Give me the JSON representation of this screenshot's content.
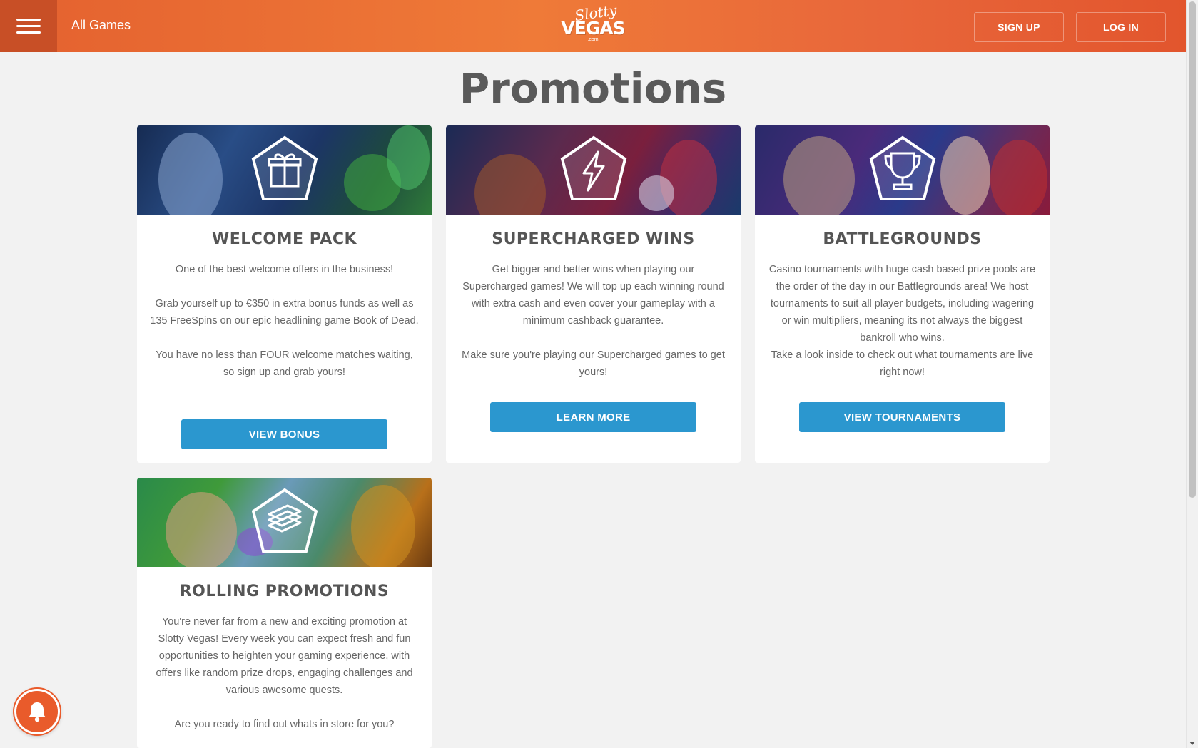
{
  "header": {
    "all_games_label": "All Games",
    "logo_top": "Slotty",
    "logo_main": "VEGAS",
    "logo_sub": ".com",
    "signup_label": "SIGN UP",
    "login_label": "LOG IN"
  },
  "page": {
    "title": "Promotions"
  },
  "colors": {
    "header_orange": "#ef7a38",
    "button_blue": "#2b97cf",
    "bell_orange": "#e95b2b"
  },
  "cards": [
    {
      "title": "WELCOME PACK",
      "icon": "gift-icon",
      "paragraphs": [
        "One of the best welcome offers in the business!",
        "Grab yourself up to €350 in extra bonus funds as well as 135 FreeSpins on our epic headlining game Book of Dead.",
        "You have no less than FOUR welcome matches waiting, so sign up and grab yours!"
      ],
      "button_label": "VIEW BONUS"
    },
    {
      "title": "SUPERCHARGED WINS",
      "icon": "lightning-icon",
      "paragraphs": [
        "Get bigger and better wins when playing our Supercharged games! We will top up each winning round with extra cash and even cover your gameplay with a minimum cashback guarantee.",
        "Make sure you're playing our Supercharged games to get yours!"
      ],
      "button_label": "LEARN MORE"
    },
    {
      "title": "BATTLEGROUNDS",
      "icon": "trophy-icon",
      "paragraphs": [
        "Casino tournaments with huge cash based prize pools are the order of the day in our Battlegrounds area! We host tournaments to suit all player budgets, including wagering or win multipliers, meaning its not always the biggest bankroll who wins.",
        "Take a look inside to check out what tournaments are live right now!"
      ],
      "button_label": "VIEW TOURNAMENTS"
    },
    {
      "title": "ROLLING PROMOTIONS",
      "icon": "cash-stack-icon",
      "paragraphs": [
        "You're never far from a new and exciting promotion at Slotty Vegas! Every week you can expect fresh and fun opportunities to heighten your gaming experience, with offers like random prize drops, engaging challenges and various awesome quests.",
        "Are you ready to find out whats in store for you?"
      ]
    }
  ]
}
